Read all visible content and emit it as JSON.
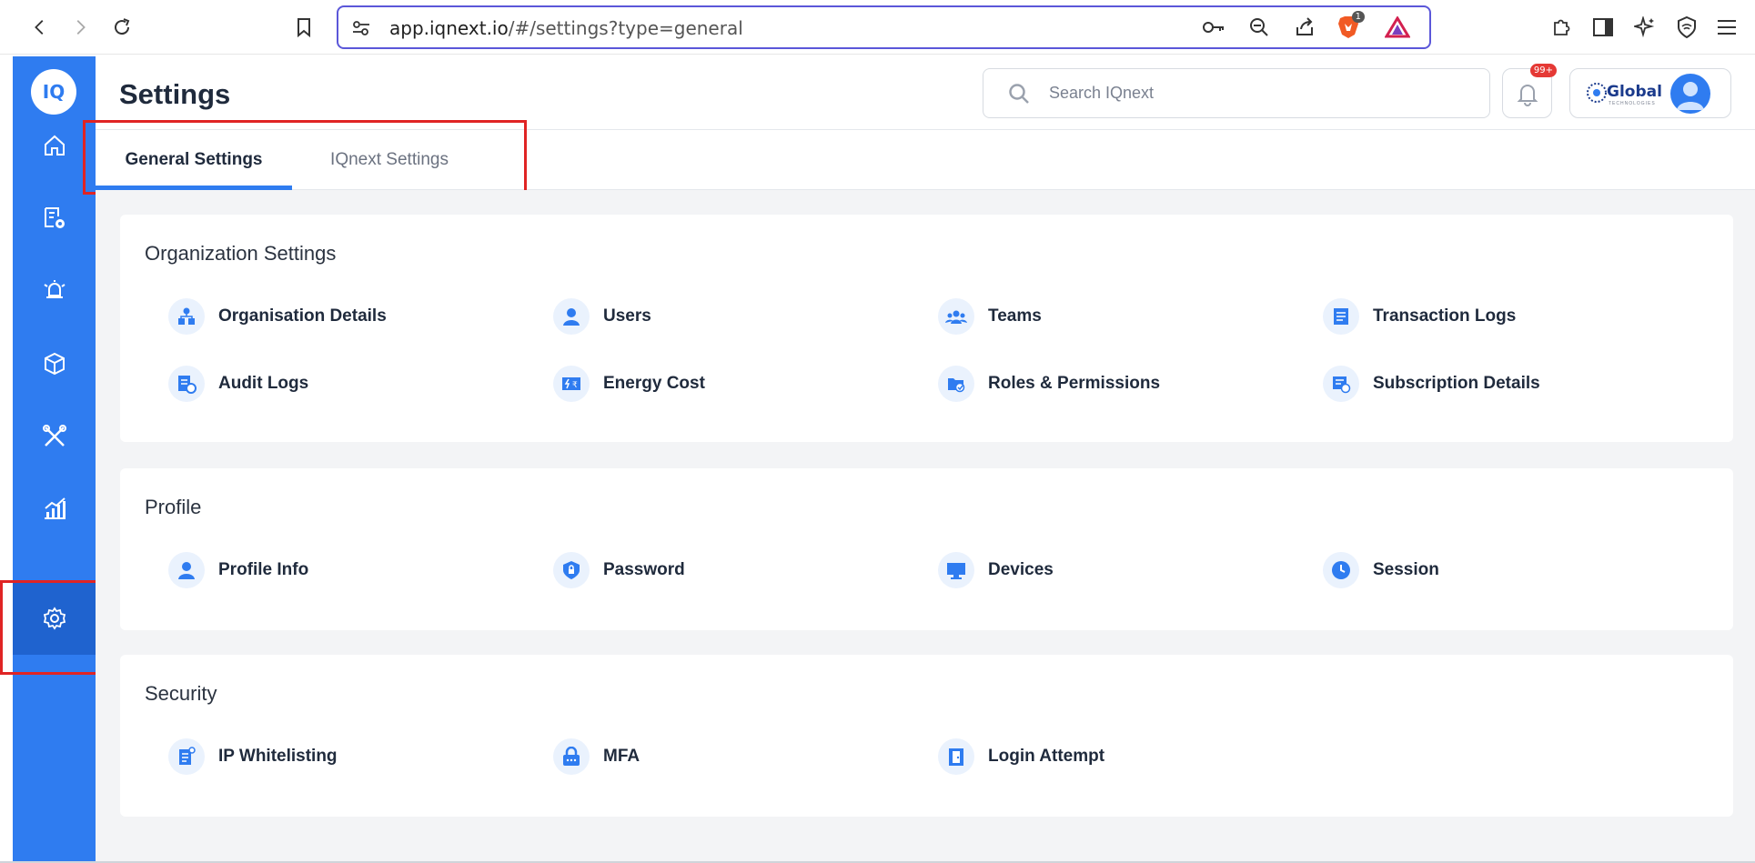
{
  "browser": {
    "url_host": "app.iqnext.io",
    "url_path": "/#/settings?type=general",
    "brave_badge": "1"
  },
  "sidebar": {
    "logo": "IQ",
    "items": [
      {
        "name": "home",
        "icon": "home-icon"
      },
      {
        "name": "config",
        "icon": "document-gear-icon"
      },
      {
        "name": "alarms",
        "icon": "alarm-bell-icon"
      },
      {
        "name": "assets",
        "icon": "cube-icon"
      },
      {
        "name": "maintenance",
        "icon": "tools-icon"
      },
      {
        "name": "analytics",
        "icon": "chart-icon"
      },
      {
        "name": "settings",
        "icon": "gear-icon",
        "active": true
      }
    ]
  },
  "header": {
    "title": "Settings",
    "search_placeholder": "Search IQnext",
    "notification_badge": "99+",
    "org_logo_text": "Global",
    "org_logo_sub": "TECHNOLOGIES"
  },
  "tabs": [
    {
      "label": "General Settings",
      "active": true
    },
    {
      "label": "IQnext Settings",
      "active": false
    }
  ],
  "sections": {
    "organization": {
      "title": "Organization Settings",
      "items": [
        "Organisation Details",
        "Users",
        "Teams",
        "Transaction Logs",
        "Audit Logs",
        "Energy Cost",
        "Roles & Permissions",
        "Subscription Details"
      ]
    },
    "profile": {
      "title": "Profile",
      "items": [
        "Profile Info",
        "Password",
        "Devices",
        "Session"
      ]
    },
    "security": {
      "title": "Security",
      "items": [
        "IP Whitelisting",
        "MFA",
        "Login Attempt"
      ]
    }
  },
  "colors": {
    "accent": "#2f7cf0",
    "sidebar_active": "#1f63cf",
    "highlight_box": "#e02424",
    "icon_bg": "#eaf2fd"
  }
}
